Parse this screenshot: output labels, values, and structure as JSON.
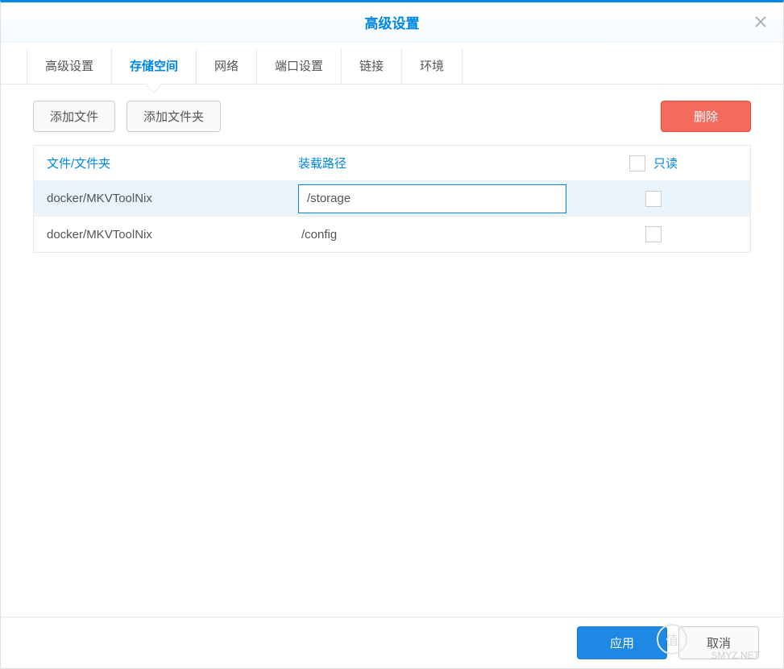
{
  "header": {
    "title": "高级设置"
  },
  "tabs": {
    "items": [
      {
        "label": "高级设置"
      },
      {
        "label": "存储空间"
      },
      {
        "label": "网络"
      },
      {
        "label": "端口设置"
      },
      {
        "label": "链接"
      },
      {
        "label": "环境"
      }
    ],
    "activeIndex": 1
  },
  "toolbar": {
    "add_file": "添加文件",
    "add_folder": "添加文件夹",
    "delete": "删除"
  },
  "table": {
    "headers": {
      "file": "文件/文件夹",
      "path": "装载路径",
      "readonly": "只读"
    },
    "rows": [
      {
        "file": "docker/MKVToolNix",
        "path": "/storage",
        "readonly": false,
        "editing": true,
        "selected": true
      },
      {
        "file": "docker/MKVToolNix",
        "path": "/config",
        "readonly": false,
        "editing": false,
        "selected": false
      }
    ]
  },
  "footer": {
    "apply": "应用",
    "cancel": "取消"
  },
  "watermark": {
    "site": "SMYZ.NET",
    "badge": "值"
  }
}
